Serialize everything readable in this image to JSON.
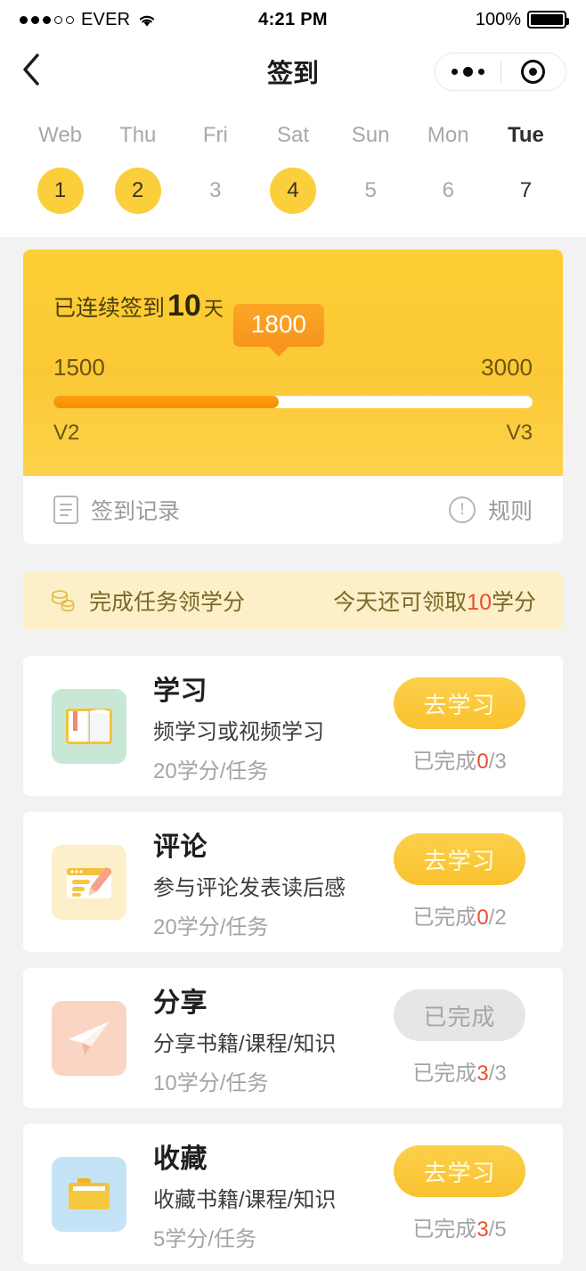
{
  "status_bar": {
    "carrier": "EVER",
    "signal_dots_total": 5,
    "signal_dots_filled": 3,
    "time": "4:21 PM",
    "battery_percent": "100%",
    "wifi_icon": "wifi-icon"
  },
  "nav": {
    "back_icon": "chevron-left-icon",
    "title": "签到",
    "capsule": {
      "more_icon": "more-dots-icon",
      "target_icon": "target-circle-icon"
    }
  },
  "week": {
    "days": [
      {
        "name": "Web",
        "date": "1",
        "checked": true,
        "today": false
      },
      {
        "name": "Thu",
        "date": "2",
        "checked": true,
        "today": false
      },
      {
        "name": "Fri",
        "date": "3",
        "checked": false,
        "today": false
      },
      {
        "name": "Sat",
        "date": "4",
        "checked": true,
        "today": false
      },
      {
        "name": "Sun",
        "date": "5",
        "checked": false,
        "today": false
      },
      {
        "name": "Mon",
        "date": "6",
        "checked": false,
        "today": false
      },
      {
        "name": "Tue",
        "date": "7",
        "checked": false,
        "today": true
      }
    ]
  },
  "signin_card": {
    "streak_prefix": "已连续签到",
    "streak_days": "10",
    "streak_unit": "天",
    "progress": {
      "min_label": "1500",
      "max_label": "3000",
      "current_label": "1800",
      "fill_percent": 47,
      "level_from": "V2",
      "level_to": "V3"
    }
  },
  "action_row": {
    "record": {
      "icon": "record-list-icon",
      "label": "签到记录"
    },
    "rules": {
      "icon": "exclamation-circle-icon",
      "label": "规则",
      "glyph": "!"
    }
  },
  "credits_banner": {
    "icon": "coins-stack-icon",
    "label": "完成任务领学分",
    "right_prefix": "今天还可领取",
    "right_amount": "10",
    "right_suffix": "学分",
    "highlight_color": "#e8502c"
  },
  "tasks": [
    {
      "icon": "open-book-icon",
      "icon_bg": "#c9e7d5",
      "title": "学习",
      "subtitle": "频学习或视频学习",
      "credit": "20学分/任务",
      "button_label": "去学习",
      "button_state": "active",
      "progress_prefix": "已完成",
      "progress_done": "0",
      "progress_total": "/3"
    },
    {
      "icon": "comment-pencil-icon",
      "icon_bg": "#fcefc9",
      "title": "评论",
      "subtitle": "参与评论发表读后感",
      "credit": "20学分/任务",
      "button_label": "去学习",
      "button_state": "active",
      "progress_prefix": "已完成",
      "progress_done": "0",
      "progress_total": "/2"
    },
    {
      "icon": "paper-plane-icon",
      "icon_bg": "#fad5c3",
      "title": "分享",
      "subtitle": "分享书籍/课程/知识",
      "credit": "10学分/任务",
      "button_label": "已完成",
      "button_state": "done",
      "progress_prefix": "已完成",
      "progress_done": "3",
      "progress_total": "/3"
    },
    {
      "icon": "folder-icon",
      "icon_bg": "#c5e3f7",
      "title": "收藏",
      "subtitle": "收藏书籍/课程/知识",
      "credit": "5学分/任务",
      "button_label": "去学习",
      "button_state": "active",
      "progress_prefix": "已完成",
      "progress_done": "3",
      "progress_total": "/5"
    }
  ],
  "colors": {
    "brand_yellow": "#fbc936",
    "accent_orange": "#f7941d",
    "highlight_red": "#e8502c",
    "page_bg": "#f2f2f2"
  }
}
